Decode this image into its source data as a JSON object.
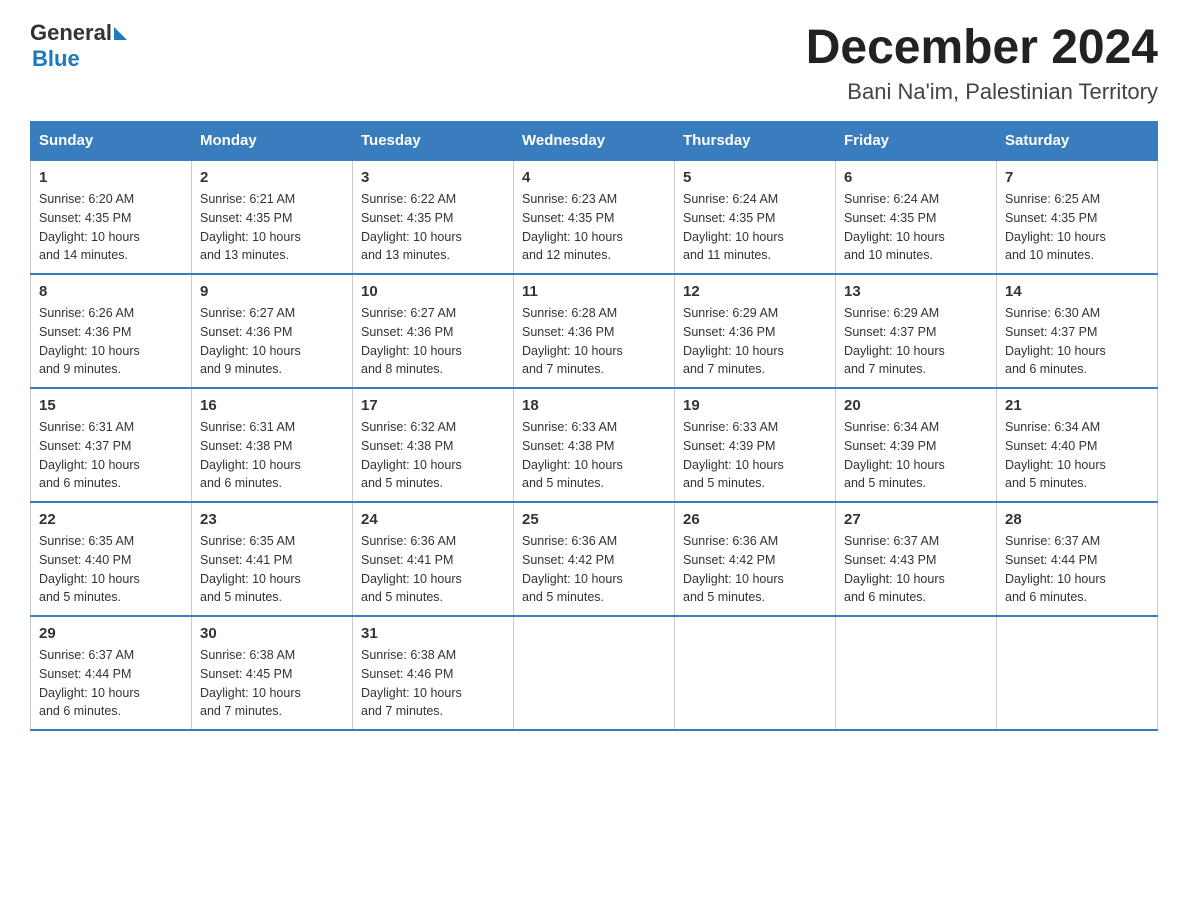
{
  "logo": {
    "general": "General",
    "blue": "Blue",
    "triangle": "▶"
  },
  "title": "December 2024",
  "subtitle": "Bani Na'im, Palestinian Territory",
  "header_days": [
    "Sunday",
    "Monday",
    "Tuesday",
    "Wednesday",
    "Thursday",
    "Friday",
    "Saturday"
  ],
  "weeks": [
    [
      {
        "day": "1",
        "sunrise": "6:20 AM",
        "sunset": "4:35 PM",
        "daylight": "10 hours and 14 minutes."
      },
      {
        "day": "2",
        "sunrise": "6:21 AM",
        "sunset": "4:35 PM",
        "daylight": "10 hours and 13 minutes."
      },
      {
        "day": "3",
        "sunrise": "6:22 AM",
        "sunset": "4:35 PM",
        "daylight": "10 hours and 13 minutes."
      },
      {
        "day": "4",
        "sunrise": "6:23 AM",
        "sunset": "4:35 PM",
        "daylight": "10 hours and 12 minutes."
      },
      {
        "day": "5",
        "sunrise": "6:24 AM",
        "sunset": "4:35 PM",
        "daylight": "10 hours and 11 minutes."
      },
      {
        "day": "6",
        "sunrise": "6:24 AM",
        "sunset": "4:35 PM",
        "daylight": "10 hours and 10 minutes."
      },
      {
        "day": "7",
        "sunrise": "6:25 AM",
        "sunset": "4:35 PM",
        "daylight": "10 hours and 10 minutes."
      }
    ],
    [
      {
        "day": "8",
        "sunrise": "6:26 AM",
        "sunset": "4:36 PM",
        "daylight": "10 hours and 9 minutes."
      },
      {
        "day": "9",
        "sunrise": "6:27 AM",
        "sunset": "4:36 PM",
        "daylight": "10 hours and 9 minutes."
      },
      {
        "day": "10",
        "sunrise": "6:27 AM",
        "sunset": "4:36 PM",
        "daylight": "10 hours and 8 minutes."
      },
      {
        "day": "11",
        "sunrise": "6:28 AM",
        "sunset": "4:36 PM",
        "daylight": "10 hours and 7 minutes."
      },
      {
        "day": "12",
        "sunrise": "6:29 AM",
        "sunset": "4:36 PM",
        "daylight": "10 hours and 7 minutes."
      },
      {
        "day": "13",
        "sunrise": "6:29 AM",
        "sunset": "4:37 PM",
        "daylight": "10 hours and 7 minutes."
      },
      {
        "day": "14",
        "sunrise": "6:30 AM",
        "sunset": "4:37 PM",
        "daylight": "10 hours and 6 minutes."
      }
    ],
    [
      {
        "day": "15",
        "sunrise": "6:31 AM",
        "sunset": "4:37 PM",
        "daylight": "10 hours and 6 minutes."
      },
      {
        "day": "16",
        "sunrise": "6:31 AM",
        "sunset": "4:38 PM",
        "daylight": "10 hours and 6 minutes."
      },
      {
        "day": "17",
        "sunrise": "6:32 AM",
        "sunset": "4:38 PM",
        "daylight": "10 hours and 5 minutes."
      },
      {
        "day": "18",
        "sunrise": "6:33 AM",
        "sunset": "4:38 PM",
        "daylight": "10 hours and 5 minutes."
      },
      {
        "day": "19",
        "sunrise": "6:33 AM",
        "sunset": "4:39 PM",
        "daylight": "10 hours and 5 minutes."
      },
      {
        "day": "20",
        "sunrise": "6:34 AM",
        "sunset": "4:39 PM",
        "daylight": "10 hours and 5 minutes."
      },
      {
        "day": "21",
        "sunrise": "6:34 AM",
        "sunset": "4:40 PM",
        "daylight": "10 hours and 5 minutes."
      }
    ],
    [
      {
        "day": "22",
        "sunrise": "6:35 AM",
        "sunset": "4:40 PM",
        "daylight": "10 hours and 5 minutes."
      },
      {
        "day": "23",
        "sunrise": "6:35 AM",
        "sunset": "4:41 PM",
        "daylight": "10 hours and 5 minutes."
      },
      {
        "day": "24",
        "sunrise": "6:36 AM",
        "sunset": "4:41 PM",
        "daylight": "10 hours and 5 minutes."
      },
      {
        "day": "25",
        "sunrise": "6:36 AM",
        "sunset": "4:42 PM",
        "daylight": "10 hours and 5 minutes."
      },
      {
        "day": "26",
        "sunrise": "6:36 AM",
        "sunset": "4:42 PM",
        "daylight": "10 hours and 5 minutes."
      },
      {
        "day": "27",
        "sunrise": "6:37 AM",
        "sunset": "4:43 PM",
        "daylight": "10 hours and 6 minutes."
      },
      {
        "day": "28",
        "sunrise": "6:37 AM",
        "sunset": "4:44 PM",
        "daylight": "10 hours and 6 minutes."
      }
    ],
    [
      {
        "day": "29",
        "sunrise": "6:37 AM",
        "sunset": "4:44 PM",
        "daylight": "10 hours and 6 minutes."
      },
      {
        "day": "30",
        "sunrise": "6:38 AM",
        "sunset": "4:45 PM",
        "daylight": "10 hours and 7 minutes."
      },
      {
        "day": "31",
        "sunrise": "6:38 AM",
        "sunset": "4:46 PM",
        "daylight": "10 hours and 7 minutes."
      },
      null,
      null,
      null,
      null
    ]
  ],
  "labels": {
    "sunrise": "Sunrise:",
    "sunset": "Sunset:",
    "daylight": "Daylight:"
  }
}
